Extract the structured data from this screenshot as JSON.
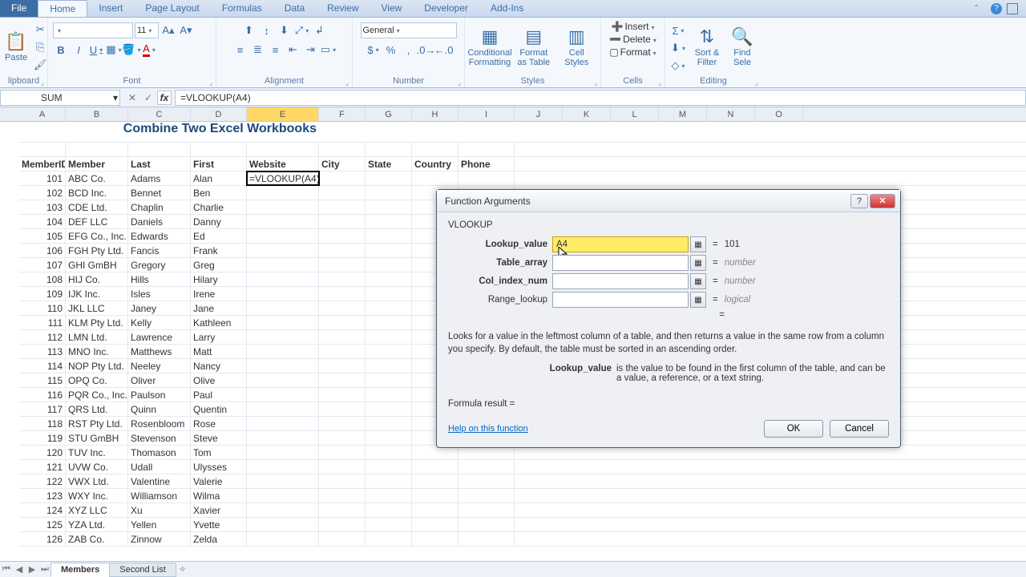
{
  "tabs": {
    "file": "File",
    "home": "Home",
    "insert": "Insert",
    "pagelayout": "Page Layout",
    "formulas": "Formulas",
    "data": "Data",
    "review": "Review",
    "view": "View",
    "developer": "Developer",
    "addins": "Add-Ins"
  },
  "groups": {
    "clipboard": "lipboard",
    "font": "Font",
    "alignment": "Alignment",
    "number": "Number",
    "styles": "Styles",
    "cells": "Cells",
    "editing": "Editing"
  },
  "clipboard": {
    "paste": "Paste"
  },
  "font": {
    "size": "11",
    "bold": "B",
    "italic": "I",
    "underline": "U"
  },
  "number": {
    "format": "General"
  },
  "styles": {
    "condfmt": "Conditional\nFormatting",
    "fmt_table": "Format\nas Table",
    "cell_styles": "Cell\nStyles"
  },
  "cells": {
    "insert": "Insert",
    "delete": "Delete",
    "format": "Format"
  },
  "editing": {
    "sort": "Sort &\nFilter",
    "find": "Find\nSele"
  },
  "namebox": "SUM",
  "formula": "=VLOOKUP(A4)",
  "columns": [
    "A",
    "B",
    "C",
    "D",
    "E",
    "F",
    "G",
    "H",
    "I",
    "J",
    "K",
    "L",
    "M",
    "N",
    "O"
  ],
  "title_row": "Combine Two Excel Workbooks",
  "headers": [
    "MemberID",
    "Member",
    "Last",
    "First",
    "Website",
    "City",
    "State",
    "Country",
    "Phone"
  ],
  "active_cell_value": "=VLOOKUP(A4)",
  "rows": [
    {
      "id": "101",
      "m": "ABC Co.",
      "l": "Adams",
      "f": "Alan"
    },
    {
      "id": "102",
      "m": "BCD Inc.",
      "l": "Bennet",
      "f": "Ben"
    },
    {
      "id": "103",
      "m": "CDE Ltd.",
      "l": "Chaplin",
      "f": "Charlie"
    },
    {
      "id": "104",
      "m": "DEF LLC",
      "l": "Daniels",
      "f": "Danny"
    },
    {
      "id": "105",
      "m": "EFG Co., Inc.",
      "l": "Edwards",
      "f": "Ed"
    },
    {
      "id": "106",
      "m": "FGH Pty Ltd.",
      "l": "Fancis",
      "f": "Frank"
    },
    {
      "id": "107",
      "m": "GHI GmBH",
      "l": "Gregory",
      "f": "Greg"
    },
    {
      "id": "108",
      "m": "HIJ Co.",
      "l": "Hills",
      "f": "Hilary"
    },
    {
      "id": "109",
      "m": "IJK Inc.",
      "l": "Isles",
      "f": "Irene"
    },
    {
      "id": "110",
      "m": "JKL LLC",
      "l": "Janey",
      "f": "Jane"
    },
    {
      "id": "111",
      "m": "KLM Pty Ltd.",
      "l": "Kelly",
      "f": "Kathleen"
    },
    {
      "id": "112",
      "m": "LMN Ltd.",
      "l": "Lawrence",
      "f": "Larry"
    },
    {
      "id": "113",
      "m": "MNO Inc.",
      "l": "Matthews",
      "f": "Matt"
    },
    {
      "id": "114",
      "m": "NOP Pty Ltd.",
      "l": "Neeley",
      "f": "Nancy"
    },
    {
      "id": "115",
      "m": "OPQ Co.",
      "l": "Oliver",
      "f": "Olive"
    },
    {
      "id": "116",
      "m": "PQR Co., Inc.",
      "l": "Paulson",
      "f": "Paul"
    },
    {
      "id": "117",
      "m": "QRS Ltd.",
      "l": "Quinn",
      "f": "Quentin"
    },
    {
      "id": "118",
      "m": "RST Pty Ltd.",
      "l": "Rosenbloom",
      "f": "Rose"
    },
    {
      "id": "119",
      "m": "STU GmBH",
      "l": "Stevenson",
      "f": "Steve"
    },
    {
      "id": "120",
      "m": "TUV Inc.",
      "l": "Thomason",
      "f": "Tom"
    },
    {
      "id": "121",
      "m": "UVW Co.",
      "l": "Udall",
      "f": "Ulysses"
    },
    {
      "id": "122",
      "m": "VWX Ltd.",
      "l": "Valentine",
      "f": "Valerie"
    },
    {
      "id": "123",
      "m": "WXY Inc.",
      "l": "Williamson",
      "f": "Wilma"
    },
    {
      "id": "124",
      "m": "XYZ LLC",
      "l": "Xu",
      "f": "Xavier"
    },
    {
      "id": "125",
      "m": "YZA Ltd.",
      "l": "Yellen",
      "f": "Yvette"
    },
    {
      "id": "126",
      "m": "ZAB Co.",
      "l": "Zinnow",
      "f": "Zelda"
    }
  ],
  "sheets": {
    "s1": "Members",
    "s2": "Second List"
  },
  "dialog": {
    "title": "Function Arguments",
    "fn": "VLOOKUP",
    "args": {
      "lookup_value": {
        "label": "Lookup_value",
        "val": "A4",
        "result": "101"
      },
      "table_array": {
        "label": "Table_array",
        "val": "",
        "result": "number"
      },
      "col_index": {
        "label": "Col_index_num",
        "val": "",
        "result": "number"
      },
      "range": {
        "label": "Range_lookup",
        "val": "",
        "result": "logical"
      }
    },
    "eq_alone": "=",
    "desc": "Looks for a value in the leftmost column of a table, and then returns a value in the same row from a column you specify. By default, the table must be sorted in an ascending order.",
    "argdesc_label": "Lookup_value",
    "argdesc": "is the value to be found in the first column of the table, and can be a value, a reference, or a text string.",
    "formula_result": "Formula result =",
    "help": "Help on this function",
    "ok": "OK",
    "cancel": "Cancel"
  }
}
